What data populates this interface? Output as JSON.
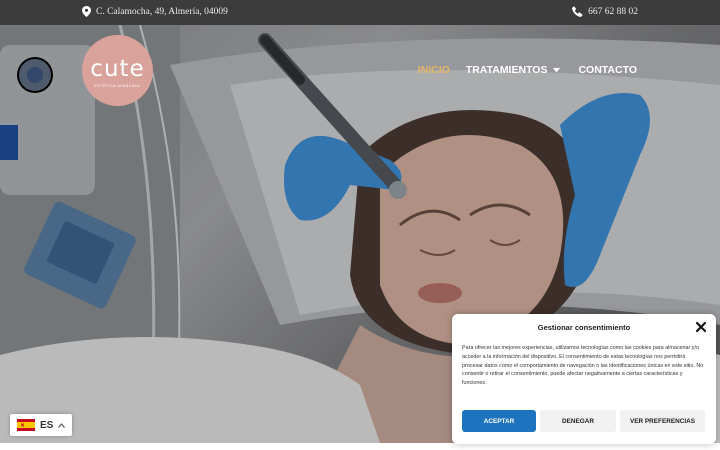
{
  "topbar": {
    "address": "C. Calamocha, 49, Almería, 04009",
    "phone": "667 62 88 02"
  },
  "logo": {
    "wordmark": "cute",
    "tagline": "ESTÉTICA AVANZADA"
  },
  "nav": {
    "items": [
      {
        "label": "INICIO",
        "active": true
      },
      {
        "label": "TRATAMIENTOS",
        "has_dropdown": true
      },
      {
        "label": "CONTACTO"
      }
    ]
  },
  "cookie_dialog": {
    "title": "Gestionar consentimiento",
    "body": "Para ofrecer las mejores experiencias, utilizamos tecnologías como las cookies para almacenar y/o acceder a la información del dispositivo. El consentimiento de estas tecnologías nos permitirá procesar datos como el comportamiento de navegación o las identificaciones únicas en este sitio. No consentir o retirar el consentimiento, puede afectar negativamente a ciertas características y funciones.",
    "accept_label": "ACEPTAR",
    "deny_label": "DENEGAR",
    "prefs_label": "VER PREFERENCIAS"
  },
  "language": {
    "code": "ES",
    "flag": "spain-flag-icon"
  },
  "colors": {
    "topbar_bg": "#3c3c3c",
    "logo_bg": "#d9a39b",
    "nav_active": "#e5b76a",
    "accept_button": "#1e73be",
    "glove_blue": "#3e8fd6"
  }
}
